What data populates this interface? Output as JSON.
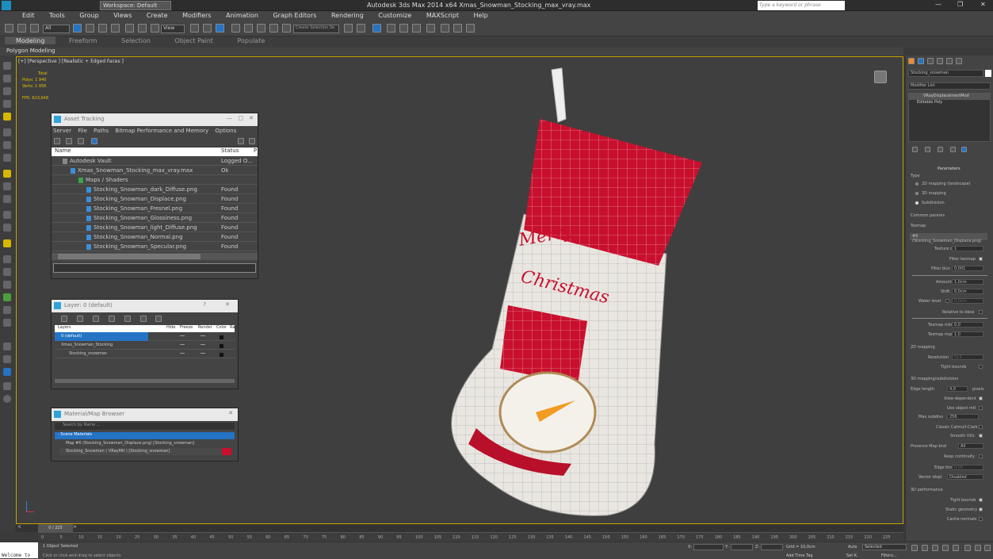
{
  "app": {
    "title": "Autodesk 3ds Max  2014 x64     Xmas_Snowman_Stocking_max_vray.max",
    "workspace": "Workspace: Default",
    "search_placeholder": "Type a keyword or phrase"
  },
  "menu": [
    "Edit",
    "Tools",
    "Group",
    "Views",
    "Create",
    "Modifiers",
    "Animation",
    "Graph Editors",
    "Rendering",
    "Customize",
    "MAXScript",
    "Help"
  ],
  "toolbar": {
    "filter": "All",
    "view": "View",
    "selection_set": "Create Selection Se"
  },
  "ribbon": {
    "tabs": [
      "Modeling",
      "Freeform",
      "Selection",
      "Object Paint",
      "Populate"
    ],
    "sub": "Polygon Modeling"
  },
  "viewport": {
    "label": "[+] [Perspective ] [Realistic + Edged Faces ]",
    "total": "Total",
    "polys": "Polys:  1 940",
    "verts": "Verts:  1 956",
    "fps": "FPS:     613,648"
  },
  "asset_tracking": {
    "title": "Asset Tracking",
    "menu": [
      "Server",
      "File",
      "Paths",
      "Bitmap Performance and Memory",
      "Options"
    ],
    "col_name": "Name",
    "col_status": "Status",
    "col_p": "P",
    "rows": [
      {
        "name": "Autodesk Vault",
        "status": "Logged O...",
        "indent": 1
      },
      {
        "name": "Xmas_Snowman_Stocking_max_vray.max",
        "status": "Ok",
        "indent": 2
      },
      {
        "name": "Maps / Shaders",
        "status": "",
        "indent": 3
      },
      {
        "name": "Stocking_Snowman_dark_Diffuse.png",
        "status": "Found",
        "indent": 4
      },
      {
        "name": "Stocking_Snowman_Displace.png",
        "status": "Found",
        "indent": 4
      },
      {
        "name": "Stocking_Snowman_Fresnel.png",
        "status": "Found",
        "indent": 4
      },
      {
        "name": "Stocking_Snowman_Glossiness.png",
        "status": "Found",
        "indent": 4
      },
      {
        "name": "Stocking_Snowman_light_Diffuse.png",
        "status": "Found",
        "indent": 4
      },
      {
        "name": "Stocking_Snowman_Normal.png",
        "status": "Found",
        "indent": 4
      },
      {
        "name": "Stocking_Snowman_Specular.png",
        "status": "Found",
        "indent": 4
      }
    ]
  },
  "layer_window": {
    "title": "Layer: 0 (default)",
    "help": "?",
    "cols": [
      "Layers",
      "Hide",
      "Freeze",
      "Render",
      "Color",
      "Radi"
    ],
    "rows": [
      {
        "name": "0 (default)",
        "sel": true
      },
      {
        "name": "Xmas_Snowman_Stocking",
        "sel": false
      },
      {
        "name": "Stocking_snowman",
        "sel": false
      }
    ]
  },
  "material_browser": {
    "title": "Material/Map Browser",
    "search": "Search by Name ...",
    "section": "- Scene Materials",
    "items": [
      "Map #6 (Stocking_Snowman_Displace.png) [Stocking_snowman]",
      "Stocking_Snowman  ( VRayMtl ) [Stocking_snowman]"
    ]
  },
  "timeline": {
    "frame": "0 / 225",
    "ticks": [
      "0",
      "5",
      "10",
      "15",
      "20",
      "25",
      "30",
      "35",
      "40",
      "45",
      "50",
      "55",
      "60",
      "65",
      "70",
      "75",
      "80",
      "85",
      "90",
      "95",
      "100",
      "105",
      "110",
      "115",
      "120",
      "125",
      "130",
      "135",
      "140",
      "145",
      "150",
      "155",
      "160",
      "165",
      "170",
      "175",
      "180",
      "185",
      "190",
      "195",
      "200",
      "205",
      "210",
      "215",
      "220",
      "225"
    ]
  },
  "status": {
    "selected": "1 Object Selected",
    "hint": "Click or click-and-drag to select objects",
    "cmd": "Welcome to",
    "x": "X:",
    "y": "Y:",
    "z": "Z:",
    "grid": "Grid = 10,0cm",
    "auto": "Auto",
    "selmode": "Selected",
    "setk": "Set K.",
    "filters": "Filters...",
    "addtag": "Add Time Tag"
  },
  "rpanel": {
    "object": "Stocking_snowman",
    "modlist": "Modifier List",
    "stack": [
      "VRayDisplacementMod",
      "Editable Poly"
    ],
    "params": "Parameters",
    "type": "Type",
    "type_opts": [
      "2D mapping (landscape)",
      "3D mapping",
      "Subdivision"
    ],
    "common": "Common params",
    "texmap": "Texmap",
    "texmap_val": "#6 (Stocking_Snowman_Displace.png)",
    "texchan": "Texture chan",
    "texchan_v": "1",
    "filtertex": "Filter texmap",
    "filterblur": "Filter blur",
    "filterblur_v": "0,001",
    "amount": "Amount",
    "amount_v": "1,0cm",
    "shift": "Shift",
    "shift_v": "0,0cm",
    "water": "Water level",
    "water_v": "0,0cm",
    "relbbox": "Relative to bbox",
    "texmin": "Texmap min",
    "texmin_v": "0,0",
    "texmax": "Texmap max",
    "texmax_v": "1,0",
    "m2d": "2D mapping",
    "res": "Resolution",
    "res_v": "512",
    "tight": "Tight bounds",
    "m3d": "3D mapping/subdivision",
    "edgelen": "Edge length",
    "edgelen_v": "4,0",
    "pixels": "pixels",
    "viewdep": "View-dependent",
    "useobj": "Use object mtl",
    "maxsub": "Max subdivs",
    "maxsub_v": "256",
    "catmull": "Classic Catmull-Clark",
    "smooth": "Smooth UVs",
    "preserve": "Preserve Map bnd",
    "preserve_v": "All",
    "keepcont": "Keep continuity",
    "edgethr": "Edge thresh",
    "edgethr_v": "0,05",
    "vecdisp": "Vector displ",
    "vecdisp_v": "Disabled",
    "perf": "3D performance",
    "tb2": "Tight bounds",
    "static": "Static geometry",
    "cache": "Cache normals"
  },
  "colors": {
    "accent": "#c8a200",
    "stocking_red": "#c8102e",
    "highlight": "#2473c4"
  }
}
